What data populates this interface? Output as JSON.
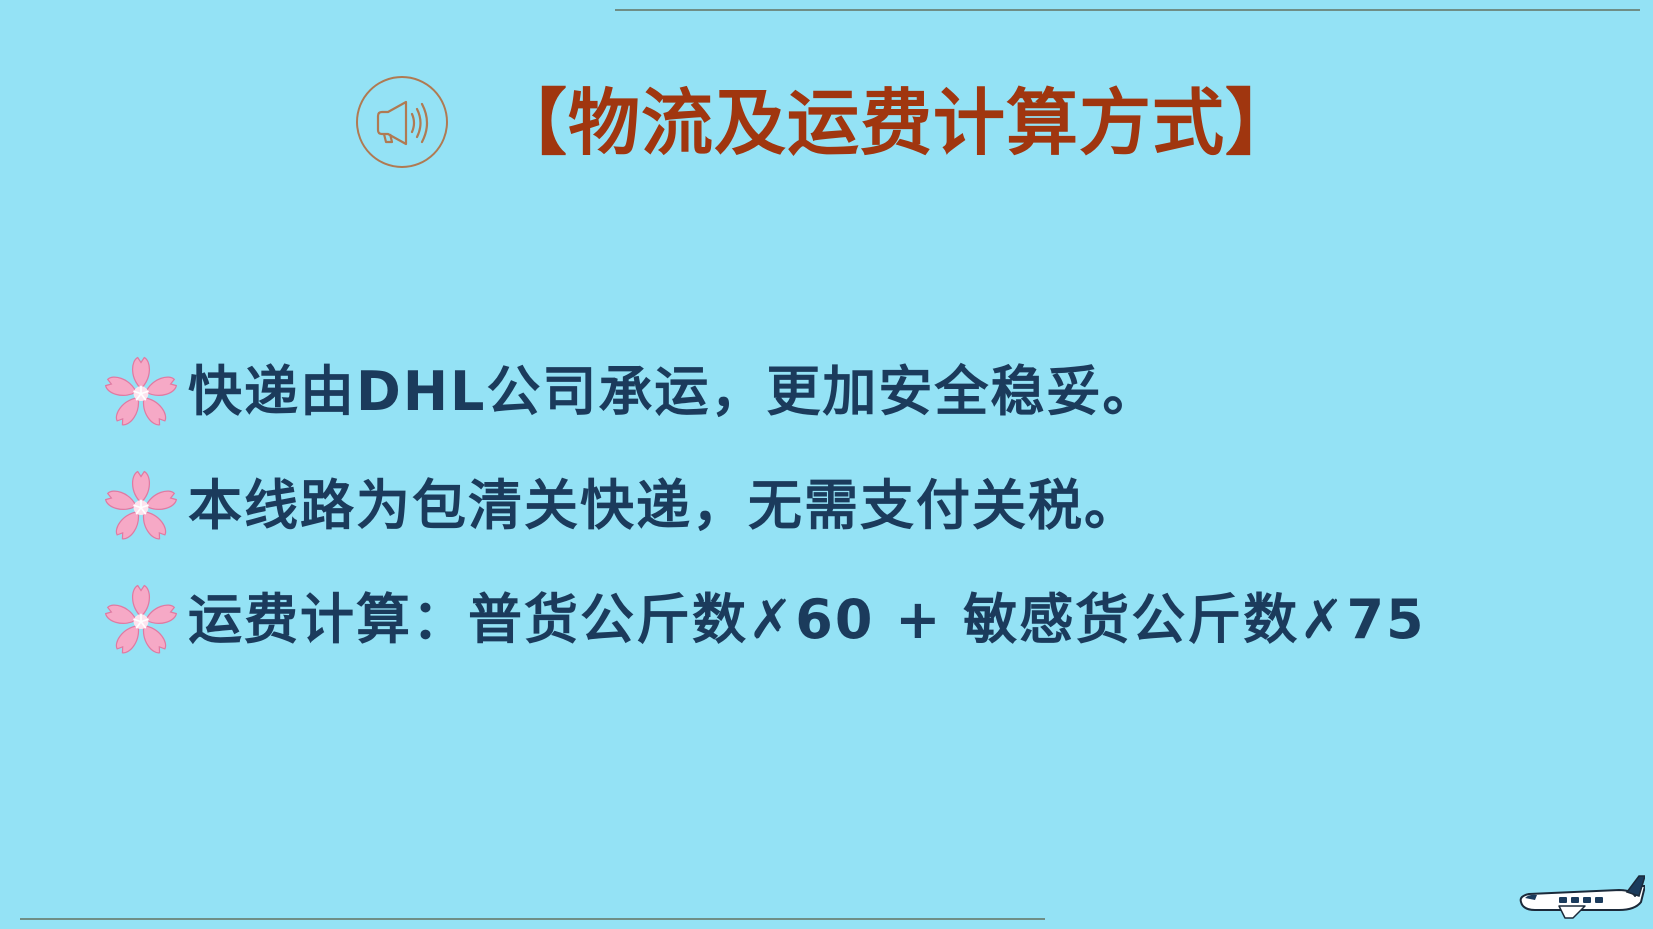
{
  "title": "【物流及运费计算方式】",
  "bullets": [
    {
      "icon": "cherry-blossom-icon",
      "text": "快递由DHL公司承运，更加安全稳妥。"
    },
    {
      "icon": "cherry-blossom-icon",
      "text": "本线路为包清关快递，无需支付关税。"
    },
    {
      "icon": "cherry-blossom-icon",
      "text": "运费计算：普货公斤数✗60 + 敏感货公斤数✗75"
    }
  ],
  "colors": {
    "background": "#94e2f5",
    "title": "#a0360f",
    "body_text": "#1b3b5c",
    "rule": "#6f8e86",
    "megaphone": "#b07a52",
    "flower": "#f6a9c6"
  },
  "icons": {
    "header": "megaphone-icon",
    "corner": "airplane-icon"
  }
}
